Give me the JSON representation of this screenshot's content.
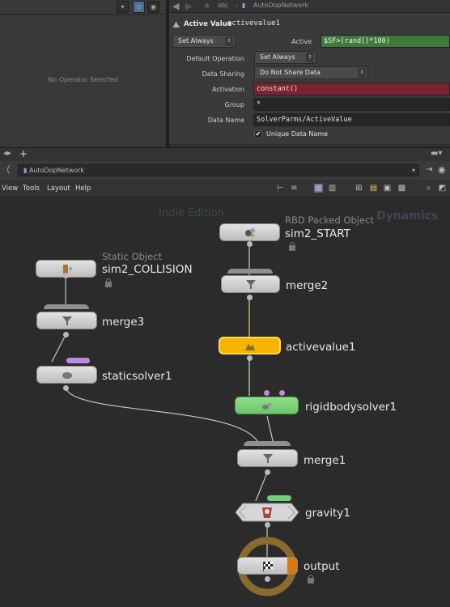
{
  "left_pane": {
    "message": "No Operator Selected"
  },
  "param_pane": {
    "path_obj": "obj",
    "path_network": "AutoDopNetwork",
    "node_type": "Active Value",
    "node_name": "activevalue1",
    "set_always_menu": "Set Always",
    "active_label": "Active",
    "active_expr": "$SF>(rand()*100)",
    "default_operation_label": "Default Operation",
    "default_operation_value": "Set Always",
    "data_sharing_label": "Data Sharing",
    "data_sharing_value": "Do Not Share Data",
    "activation_label": "Activation",
    "activation_value": "constant()",
    "group_label": "Group",
    "group_value": "*",
    "data_name_label": "Data Name",
    "data_name_value": "SolverParms/ActiveValue",
    "unique_data_name_label": "Unique Data Name",
    "unique_data_name_checked": true
  },
  "network": {
    "path": "AutoDopNetwork",
    "menu": [
      "View",
      "Tools",
      "Layout",
      "Help"
    ],
    "watermark_edition": "Indie Edition",
    "watermark_context": "Dynamics",
    "nodes": {
      "sim2_start": {
        "type": "RBD Packed Object",
        "name": "sim2_START"
      },
      "sim2_collision": {
        "type": "Static Object",
        "name": "sim2_COLLISION"
      },
      "merge2": {
        "name": "merge2"
      },
      "merge3": {
        "name": "merge3"
      },
      "activevalue1": {
        "name": "activevalue1"
      },
      "staticsolver1": {
        "name": "staticsolver1"
      },
      "rigidbodysolver1": {
        "name": "rigidbodysolver1"
      },
      "merge1": {
        "name": "merge1"
      },
      "gravity1": {
        "name": "gravity1"
      },
      "output": {
        "name": "output"
      }
    }
  },
  "colors": {
    "active_node": "#f5b400",
    "solver_node": "#7fd17a",
    "activation_field": "#7a2230",
    "active_expr_field": "#3f7a3a",
    "subdata_dot": "#b98ce0",
    "gravity_pill": "#6fcf7a",
    "output_ring": "#8b6a2e",
    "output_flag": "#d9780f"
  }
}
